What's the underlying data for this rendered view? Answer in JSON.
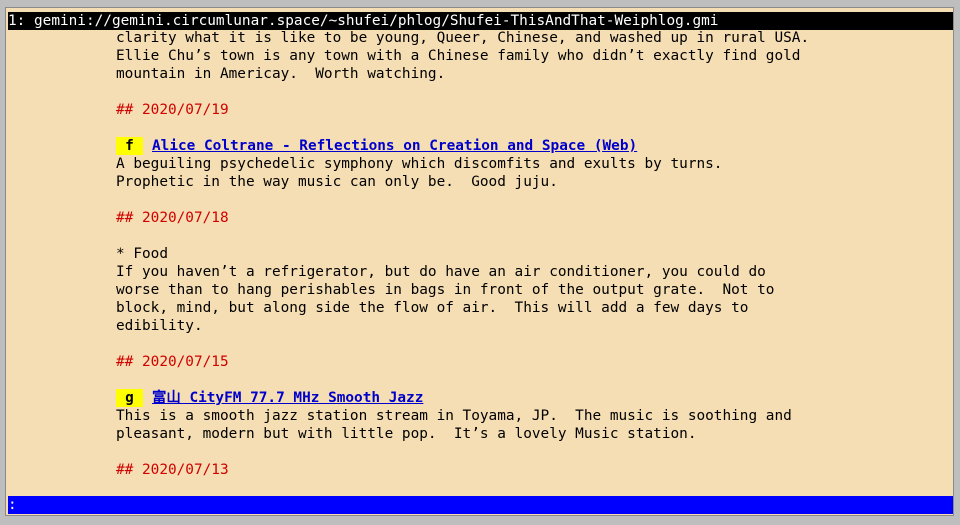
{
  "window": {
    "title": "1: gemini://gemini.circumlunar.space/~shufei/phlog/Shufei-ThisAndThat-Weiphlog.gmi"
  },
  "content": {
    "intro_lines": [
      "clarity what it is like to be young, Queer, Chinese, and washed up in rural USA.",
      "Ellie Chu’s town is any town with a Chinese family who didn’t exactly find gold",
      "mountain in Americay.  Worth watching."
    ],
    "entries": [
      {
        "heading": "## 2020/07/19",
        "link_key": "f",
        "link_text": "Alice Coltrane - Reflections on Creation and Space (Web)",
        "lines": [
          "A beguiling psychedelic symphony which discomfits and exults by turns.",
          "Prophetic in the way music can only be.  Good juju."
        ]
      },
      {
        "heading": "## 2020/07/18",
        "bullet": "* Food",
        "lines": [
          "If you haven’t a refrigerator, but do have an air conditioner, you could do",
          "worse than to hang perishables in bags in front of the output grate.  Not to",
          "block, mind, but along side the flow of air.  This will add a few days to",
          "edibility."
        ]
      },
      {
        "heading": "## 2020/07/15",
        "link_key": "g",
        "link_text": "富山 CityFM 77.7 MHz Smooth Jazz",
        "lines": [
          "This is a smooth jazz station stream in Toyama, JP.  The music is soothing and",
          "pleasant, modern but with little pop.  It’s a lovely Music station."
        ]
      },
      {
        "heading": "## 2020/07/13"
      }
    ]
  },
  "statusbar": {
    "text": ":"
  },
  "colors": {
    "page_background": "#f5deb3",
    "heading": "#d00000",
    "link": "#0000cc",
    "key_badge": "#ffff00",
    "statusbar": "#0000ff",
    "titlebar": "#000000"
  }
}
